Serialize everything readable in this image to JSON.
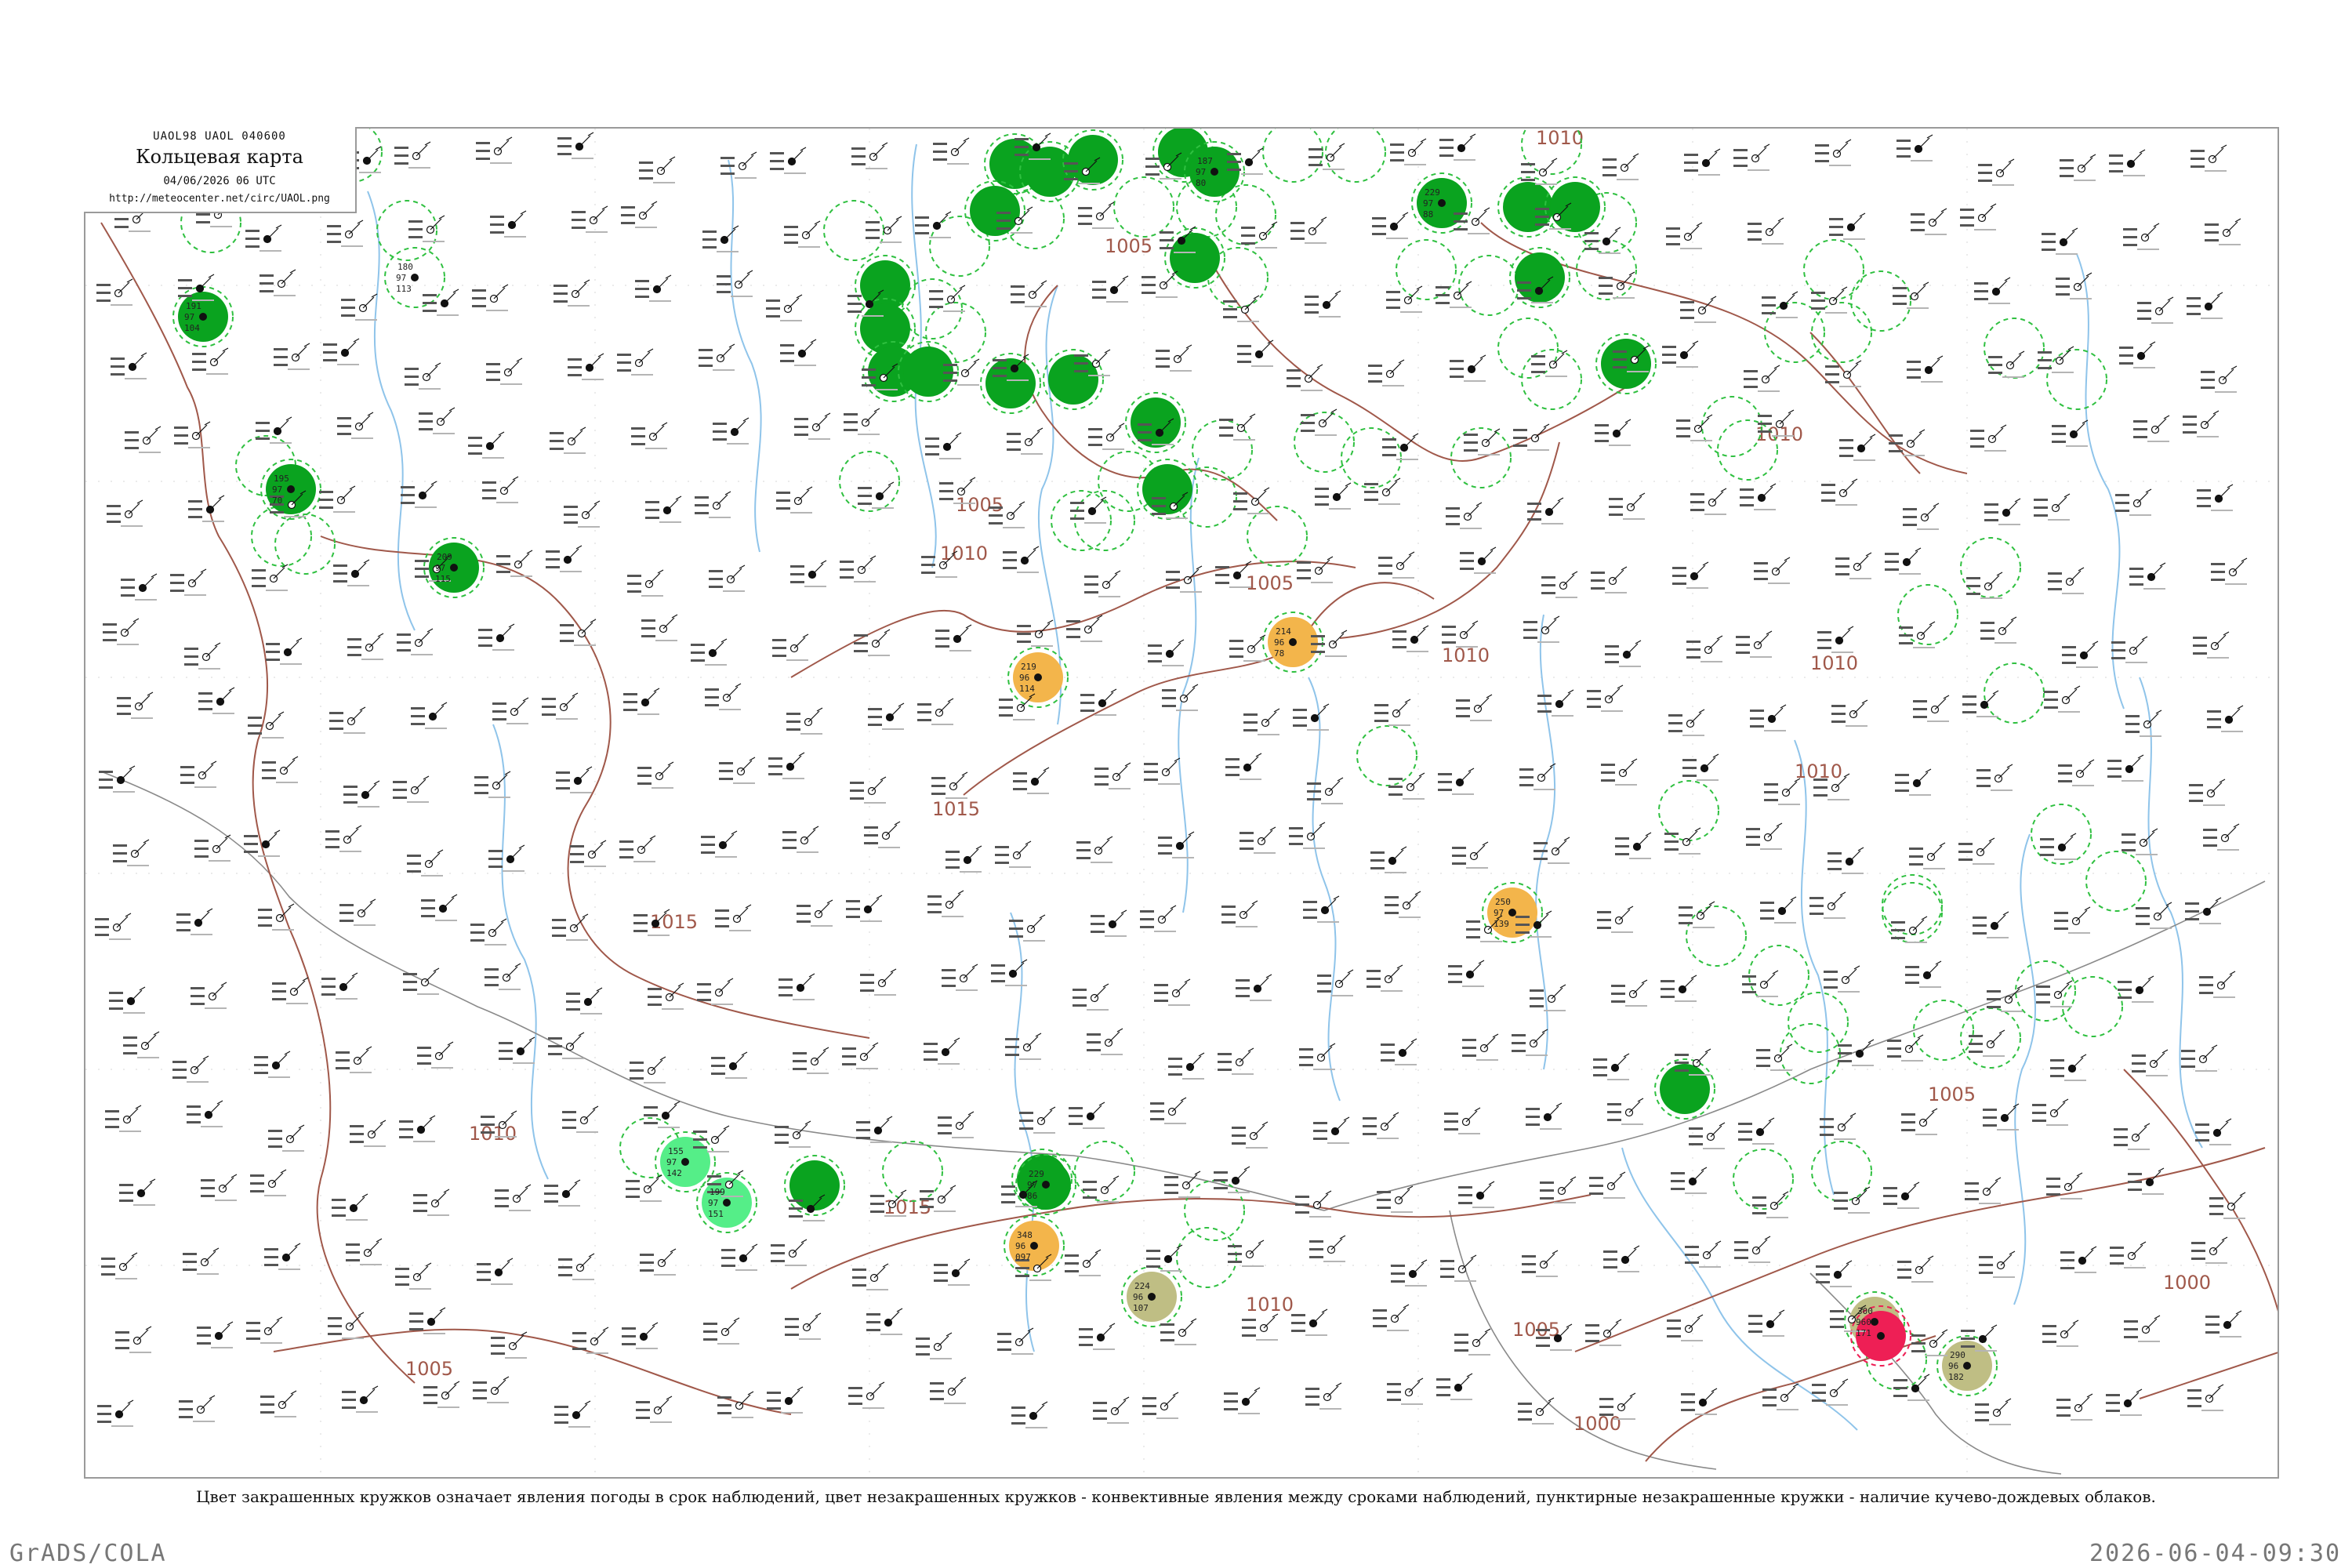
{
  "header": {
    "code": "UAOL98  UAOL  040600",
    "title": "Кольцевая карта",
    "datetime": "04/06/2026 06 UTC",
    "url": "http://meteocenter.net/circ/UAOL.png"
  },
  "caption": "Цвет закрашенных кружков означает явления погоды в срок наблюдений, цвет незакрашенных кружков - конвективные явления между сроками наблюдений, пунктирные незакрашенные кружки - наличие кучево-дождевых облаков.",
  "footer": {
    "left": "GrADS/COLA",
    "right": "2026-06-04-09:30"
  },
  "colors": {
    "isobar": "#a0584a",
    "river": "#8fc4ea",
    "border": "#808080",
    "rain_fill": "#0aa31f",
    "rain_ring": "#2fc040",
    "shower_dashed": "#2fc040",
    "thunder_orange": "#f3b54b",
    "haze_olive": "#bfbe84",
    "thunderstorm_red": "#ee1f55",
    "light_green": "#55ee88"
  },
  "isobars": [
    {
      "label": "1005",
      "kind": "left-bottom"
    },
    {
      "label": "1010",
      "kind": "left-mid"
    },
    {
      "label": "1015",
      "kind": "left-upper"
    },
    {
      "label": "1015",
      "kind": "center"
    },
    {
      "label": "1010",
      "kind": "center-top"
    },
    {
      "label": "1005",
      "kind": "north-low"
    },
    {
      "label": "1010",
      "kind": "north-east"
    },
    {
      "label": "1010",
      "kind": "center-east"
    },
    {
      "label": "1010",
      "kind": "east"
    },
    {
      "label": "1005",
      "kind": "south"
    },
    {
      "label": "1010",
      "kind": "south-center"
    },
    {
      "label": "1005",
      "kind": "east-low"
    },
    {
      "label": "1000",
      "kind": "south-east"
    },
    {
      "label": "1000",
      "kind": "far-east"
    }
  ],
  "stations": [
    {
      "p": "180",
      "t": "97",
      "d": "113",
      "name": "",
      "mark": "rain_dashed"
    },
    {
      "p": "191",
      "t": "97",
      "d": "104",
      "name": "",
      "mark": "rain_fill"
    },
    {
      "p": "195",
      "t": "97",
      "d": "70",
      "name": "",
      "mark": "rain_fill"
    },
    {
      "p": "209",
      "t": "97",
      "d": "115",
      "name": "",
      "mark": "rain_fill"
    },
    {
      "p": "229",
      "t": "97",
      "d": "88",
      "name": "",
      "mark": "rain_fill"
    },
    {
      "p": "187",
      "t": "97",
      "d": "80",
      "name": "",
      "mark": "rain_fill"
    },
    {
      "p": "214",
      "t": "96",
      "d": "78",
      "name": "",
      "mark": "orange"
    },
    {
      "p": "219",
      "t": "96",
      "d": "114",
      "name": "",
      "mark": "orange"
    },
    {
      "p": "250",
      "t": "97",
      "d": "139",
      "name": "",
      "mark": "orange"
    },
    {
      "p": "348",
      "t": "96",
      "d": "097",
      "name": "",
      "mark": "orange"
    },
    {
      "p": "224",
      "t": "96",
      "d": "107",
      "name": "",
      "mark": "olive"
    },
    {
      "p": "300",
      "t": "960",
      "d": "171",
      "name": "",
      "mark": "olive"
    },
    {
      "p": "229",
      "t": "97",
      "d": "86",
      "name": "",
      "mark": "rain_fill"
    },
    {
      "p": "155",
      "t": "97",
      "d": "142",
      "name": "",
      "mark": "light_green"
    },
    {
      "p": "199",
      "t": "97",
      "d": "151",
      "name": "",
      "mark": "light_green"
    },
    {
      "p": "290",
      "t": "96",
      "d": "182",
      "name": "",
      "mark": "olive"
    },
    {
      "p": "",
      "t": "",
      "d": "",
      "name": "",
      "mark": "red"
    }
  ]
}
